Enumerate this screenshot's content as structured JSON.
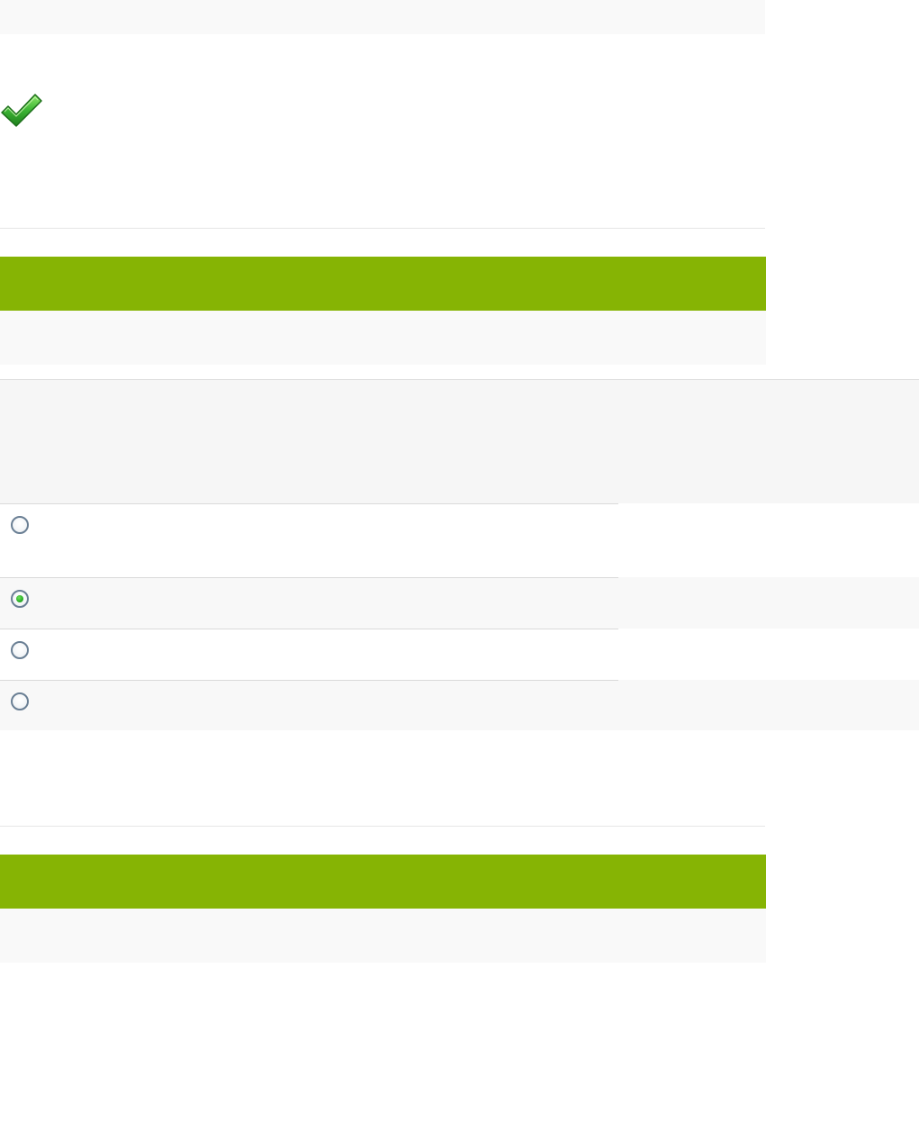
{
  "colors": {
    "accent_green": "#86b404",
    "check_green": "#3cb434",
    "radio_selected": "#2db32a"
  },
  "status": {
    "icon": "checkmark-icon"
  },
  "options": [
    {
      "label": "",
      "selected": false
    },
    {
      "label": "",
      "selected": true
    },
    {
      "label": "",
      "selected": false
    },
    {
      "label": "",
      "selected": false
    }
  ]
}
